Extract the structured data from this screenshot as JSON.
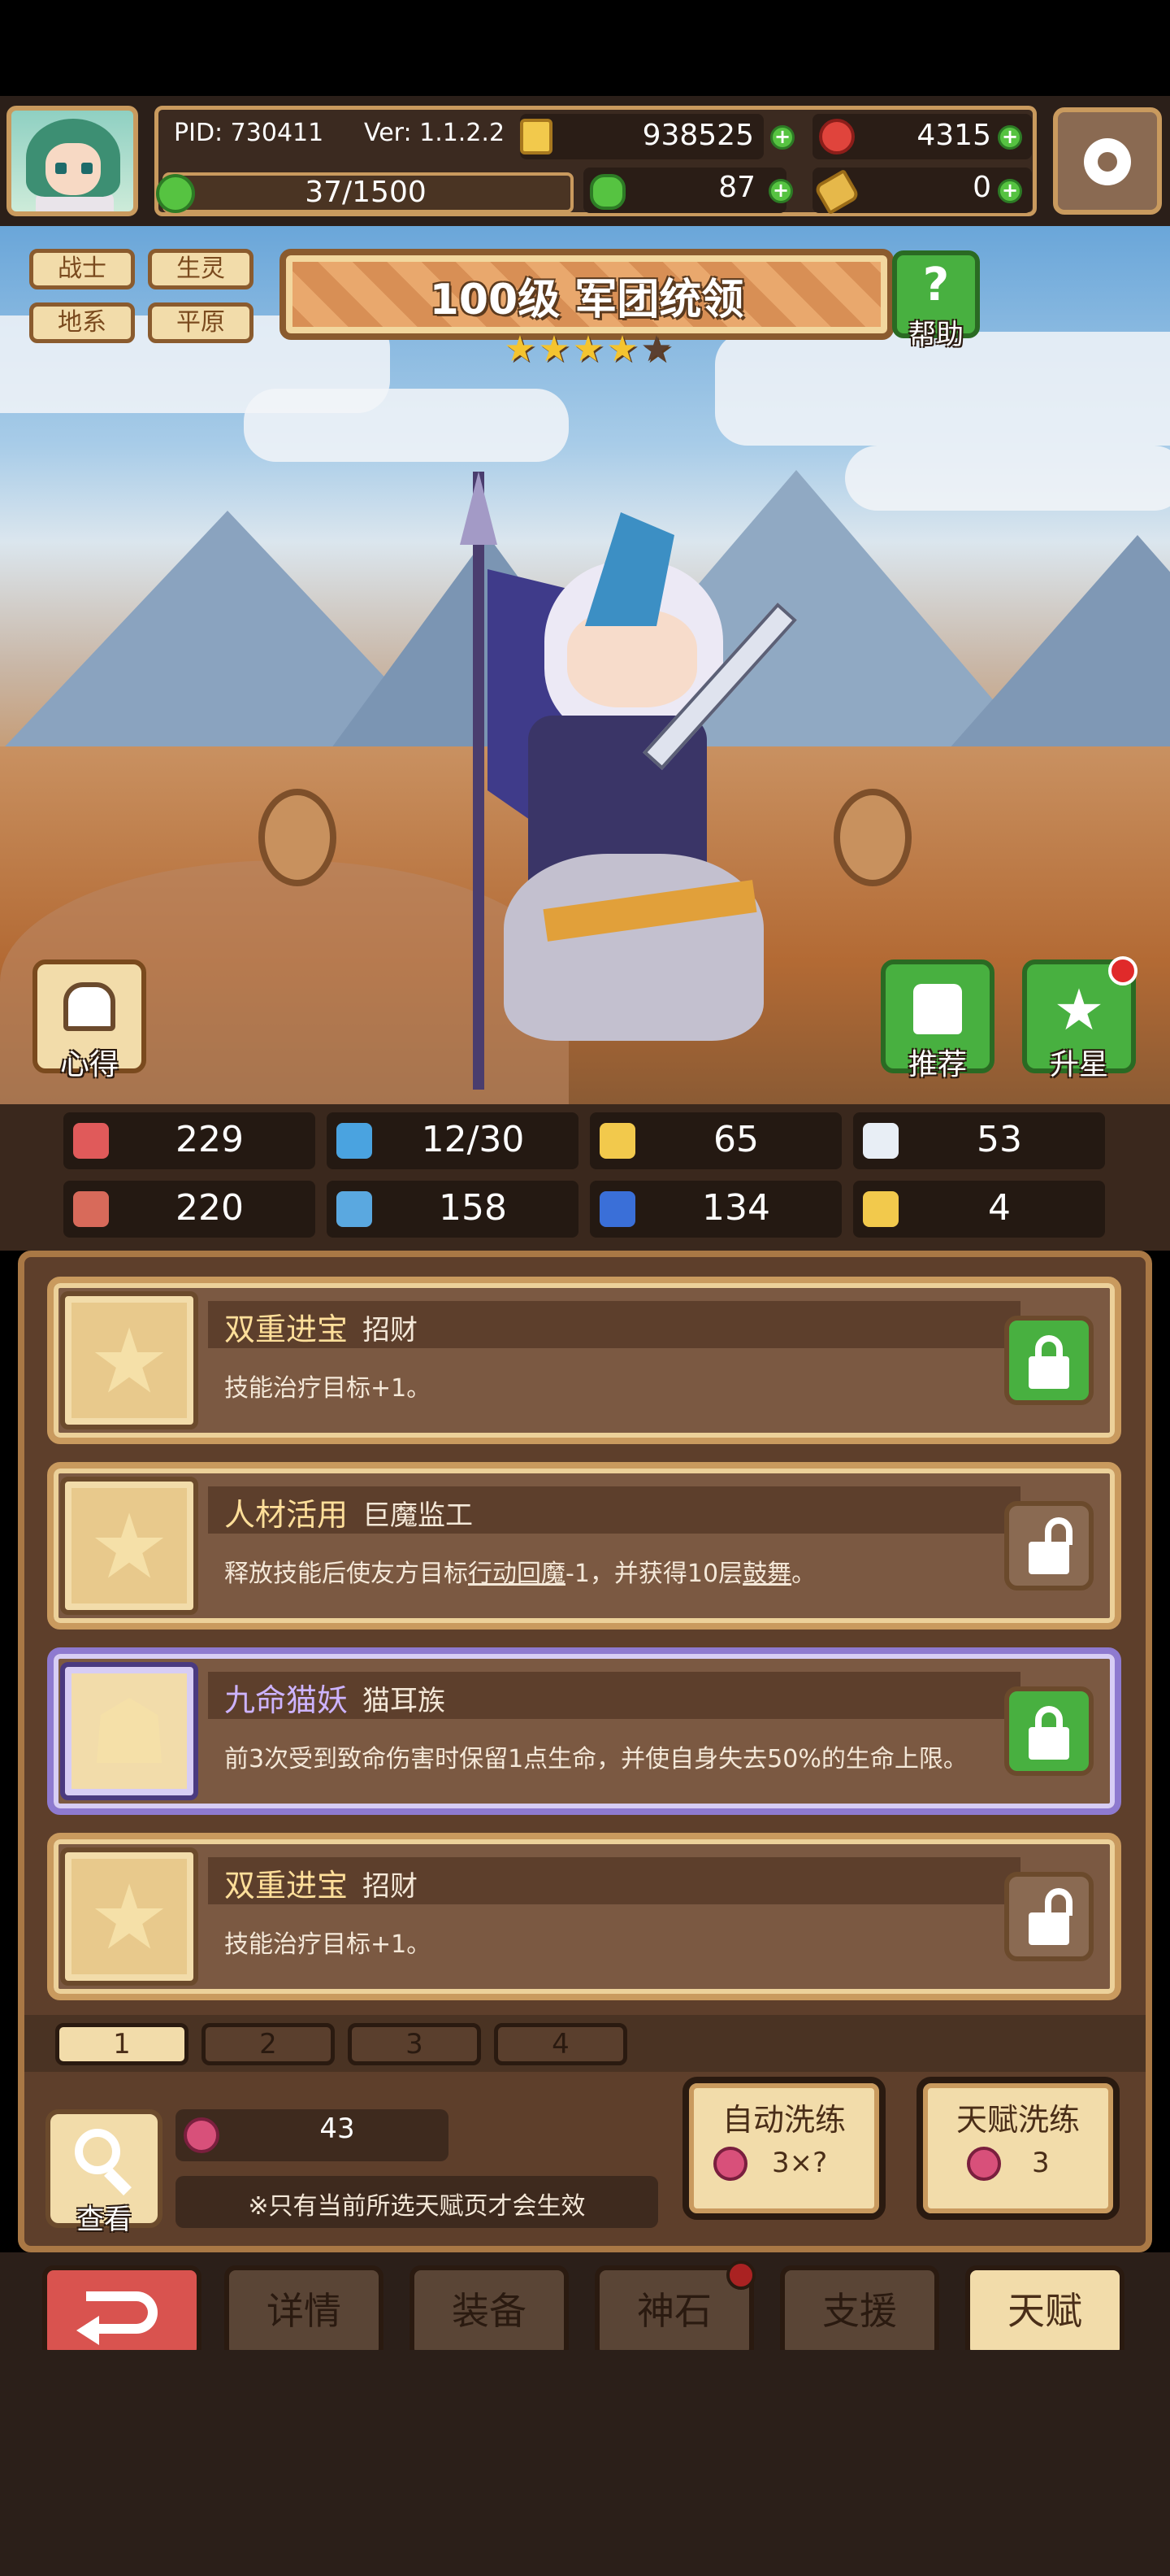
{
  "header": {
    "pid": "PID: 730411",
    "version": "Ver: 1.1.2.2",
    "gold": "938525",
    "gems": "4315",
    "stamina": "37/1500",
    "clover": "87",
    "keys": "0"
  },
  "hero": {
    "tags": [
      "战士",
      "生灵",
      "地系",
      "平原"
    ],
    "level_title": "100级  军团统领",
    "stars_filled": 4,
    "stars_total": 5,
    "help_label": "帮助",
    "notes_label": "心得",
    "recommend_label": "推荐",
    "starup_label": "升星"
  },
  "stats": [
    {
      "icon": "heart-icon",
      "value": "229"
    },
    {
      "icon": "drop-icon",
      "value": "12/30"
    },
    {
      "icon": "shield-icon",
      "value": "65"
    },
    {
      "icon": "wing-icon",
      "value": "53"
    },
    {
      "icon": "fist-icon",
      "value": "220"
    },
    {
      "icon": "book-icon",
      "value": "158"
    },
    {
      "icon": "boot-icon",
      "value": "134"
    },
    {
      "icon": "magnet-icon",
      "value": "4"
    }
  ],
  "talents": [
    {
      "name": "双重进宝",
      "tag": "招财",
      "desc": "技能治疗目标+1。",
      "locked": true,
      "rare": false
    },
    {
      "name": "人材活用",
      "tag": "巨魔监工",
      "desc_parts": [
        "释放技能后使友方目标",
        "行动回魔",
        "-1，并获得10层",
        "鼓舞",
        "。"
      ],
      "locked": false,
      "rare": false
    },
    {
      "name": "九命猫妖",
      "tag": "猫耳族",
      "desc": "前3次受到致命伤害时保留1点生命，并使自身失去50%的生命上限。",
      "locked": true,
      "rare": true
    },
    {
      "name": "双重进宝",
      "tag": "招财",
      "desc": "技能治疗目标+1。",
      "locked": false,
      "rare": false
    }
  ],
  "pages": [
    "1",
    "2",
    "3",
    "4"
  ],
  "bottom": {
    "view_label": "查看",
    "currency": "43",
    "note": "※只有当前所选天赋页才会生效",
    "auto_refine_title": "自动洗练",
    "auto_refine_cost": "3×?",
    "talent_refine_title": "天赋洗练",
    "talent_refine_cost": "3"
  },
  "nav": {
    "back_icon": "return-arrow-icon",
    "items": [
      "详情",
      "装备",
      "神石",
      "支援",
      "天赋"
    ],
    "active": "天赋"
  },
  "colors": {
    "accent_gold": "#c99a5e",
    "active_tab": "#f2dcaa",
    "back_red": "#d9534f",
    "green": "#48b040",
    "purple_rare": "#8e7ad0"
  }
}
